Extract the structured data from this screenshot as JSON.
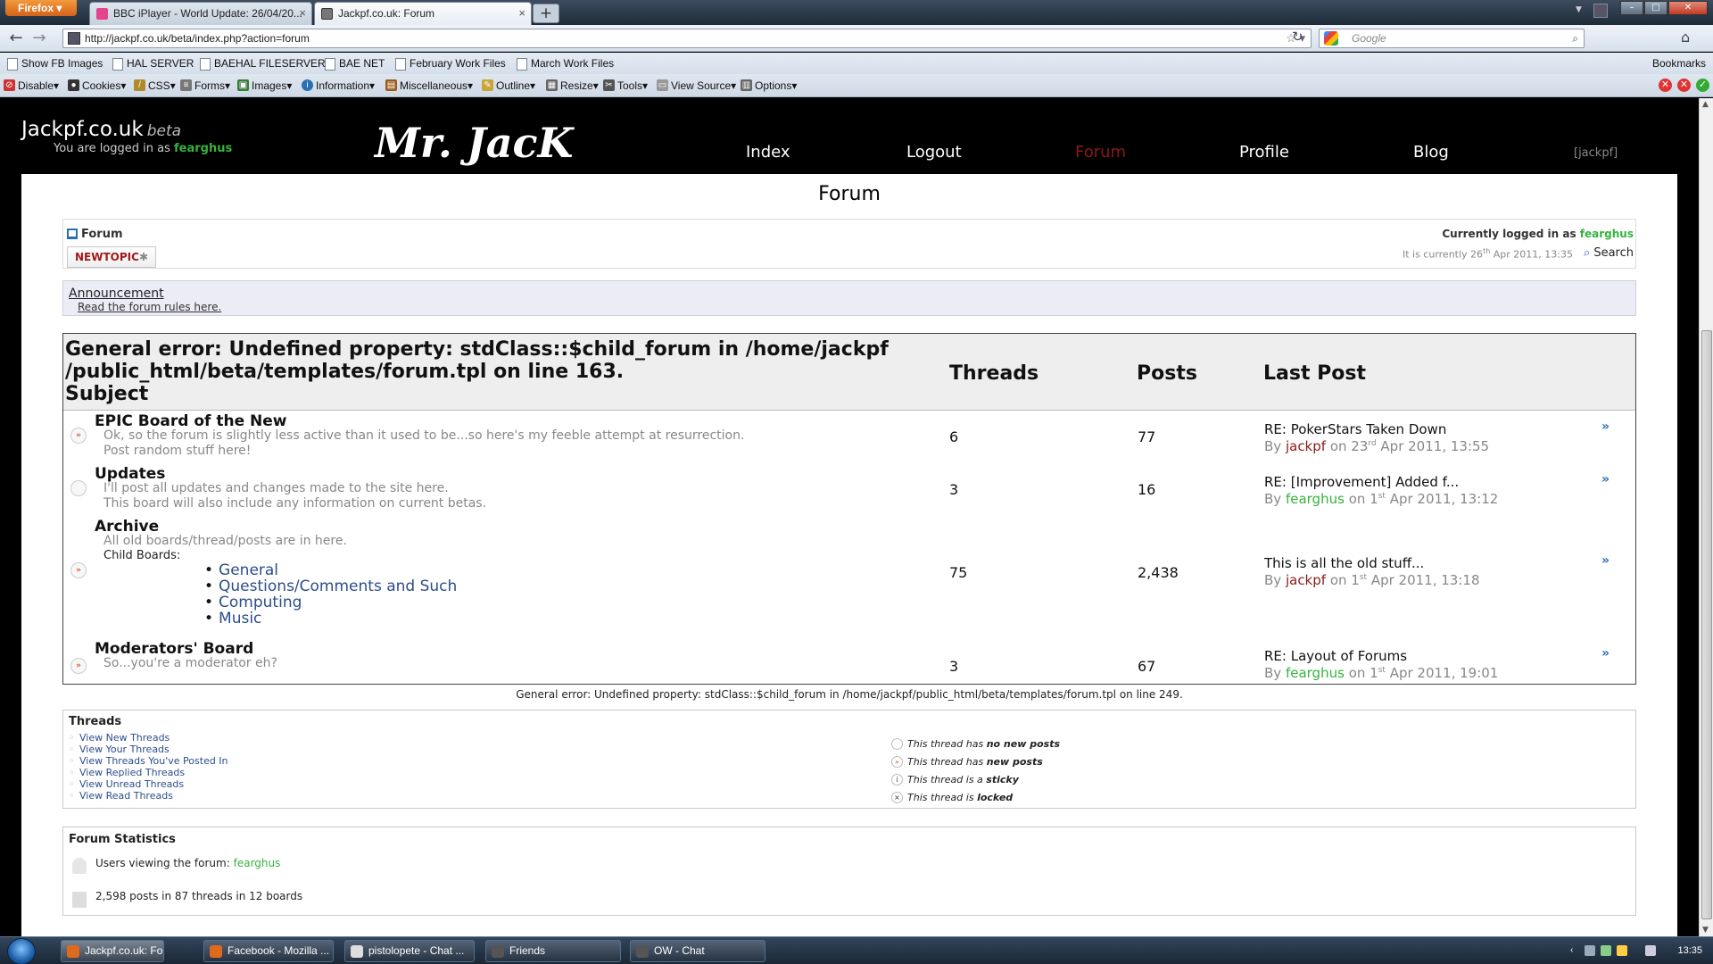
{
  "browser": {
    "app_button": "Firefox",
    "tabs": [
      {
        "title": "BBC iPlayer - World Update: 26/04/20...",
        "active": false
      },
      {
        "title": "Jackpf.co.uk: Forum",
        "active": true
      }
    ],
    "url": "http://jackpf.co.uk/beta/index.php?action=forum",
    "search_placeholder": "Google",
    "bookmarks": [
      "Show FB Images",
      "HAL SERVER",
      "BAEHAL FILESERVER",
      "BAE NET",
      "February Work Files",
      "March Work Files"
    ],
    "bookmarks_menu": "Bookmarks",
    "devtools": [
      "Disable",
      "Cookies",
      "CSS",
      "Forms",
      "Images",
      "Information",
      "Miscellaneous",
      "Outline",
      "Resize",
      "Tools",
      "View Source",
      "Options"
    ]
  },
  "site": {
    "title": "Jackpf.co.uk",
    "beta_label": "beta",
    "logged_prefix": "You are logged in as",
    "username": "fearghus",
    "logo_text": "Mr. JacK",
    "nav": [
      {
        "label": "Index",
        "current": false
      },
      {
        "label": "Logout",
        "current": false
      },
      {
        "label": "Forum",
        "current": true
      },
      {
        "label": "Profile",
        "current": false
      },
      {
        "label": "Blog",
        "current": false
      }
    ],
    "nav_user": "[jackpf]"
  },
  "page": {
    "title": "Forum",
    "breadcrumb": "Forum",
    "new_topic": "NEWTOPIC",
    "currently_logged": "Currently logged in as",
    "current_time_prefix": "It is currently 26",
    "current_time_sup": "th",
    "current_time_suffix": " Apr 2011, 13:35",
    "search": "Search",
    "announcement_heading": "Announcement",
    "announcement_text": "Read the forum rules here."
  },
  "forum_table": {
    "error_line": "General error: Undefined property: stdClass::$child_forum in /home/jackpf /public_html/beta/templates/forum.tpl on line 163.",
    "subject_header": "Subject",
    "threads_header": "Threads",
    "posts_header": "Posts",
    "lastpost_header": "Last Post",
    "forums": [
      {
        "title": "EPIC Board of the New",
        "desc": [
          "Ok, so the forum is slightly less active than it used to be...so here's my feeble attempt at resurrection.",
          "Post random stuff here!"
        ],
        "threads": "6",
        "posts": "77",
        "last_title": "RE: PokerStars Taken Down",
        "last_by": "By",
        "last_user": "jackpf",
        "last_on": "on 23",
        "last_sup": "rd",
        "last_date": " Apr 2011, 13:55",
        "new_posts": true
      },
      {
        "title": "Updates",
        "desc": [
          "I'll post all updates and changes made to the site here.",
          "This board will also include any information on current betas."
        ],
        "threads": "3",
        "posts": "16",
        "last_title": "RE: [Improvement] Added f...",
        "last_by": "By",
        "last_user": "fearghus",
        "last_on": "on 1",
        "last_sup": "st",
        "last_date": " Apr 2011, 13:12",
        "new_posts": false
      },
      {
        "title": "Archive",
        "desc": [
          "All old boards/thread/posts are in here."
        ],
        "child_label": "Child Boards:",
        "children": [
          "General",
          "Questions/Comments and Such",
          "Computing",
          "Music"
        ],
        "threads": "75",
        "posts": "2,438",
        "last_title": "This is all the old stuff...",
        "last_by": "By",
        "last_user": "jackpf",
        "last_on": "on 1",
        "last_sup": "st",
        "last_date": " Apr 2011, 13:18",
        "new_posts": true
      },
      {
        "title": "Moderators' Board",
        "desc": [
          "So...you're a moderator eh?"
        ],
        "threads": "3",
        "posts": "67",
        "last_title": "RE: Layout of Forums",
        "last_by": "By",
        "last_user": "fearghus",
        "last_on": "on 1",
        "last_sup": "st",
        "last_date": " Apr 2011, 19:01",
        "new_posts": true
      }
    ],
    "footer_error": "General error: Undefined property: stdClass::$child_forum in /home/jackpf/public_html/beta/templates/forum.tpl on line 249."
  },
  "threads_box": {
    "heading": "Threads",
    "links": [
      "View New Threads",
      "View Your Threads",
      "View Threads You've Posted In",
      "View Replied Threads",
      "View Unread Threads",
      "View Read Threads"
    ],
    "legend": [
      {
        "prefix": "This thread has ",
        "bold": "no new posts"
      },
      {
        "prefix": "This thread has ",
        "bold": "new posts"
      },
      {
        "prefix": "This thread is a ",
        "bold": "sticky"
      },
      {
        "prefix": "This thread is ",
        "bold": "locked"
      }
    ]
  },
  "stats": {
    "heading": "Forum Statistics",
    "viewing_prefix": "Users viewing the forum:",
    "viewing_user": "fearghus",
    "counts": "2,598 posts in 87 threads in 12 boards"
  },
  "taskbar": {
    "items": [
      {
        "label": "Jackpf.co.uk: Forum...",
        "active": true
      },
      {
        "label": "Facebook - Mozilla ...",
        "active": false
      },
      {
        "label": "pistolopete - Chat ...",
        "active": false
      },
      {
        "label": "Friends",
        "active": false
      },
      {
        "label": "OW - Chat",
        "active": false
      }
    ],
    "clock": "13:35"
  }
}
